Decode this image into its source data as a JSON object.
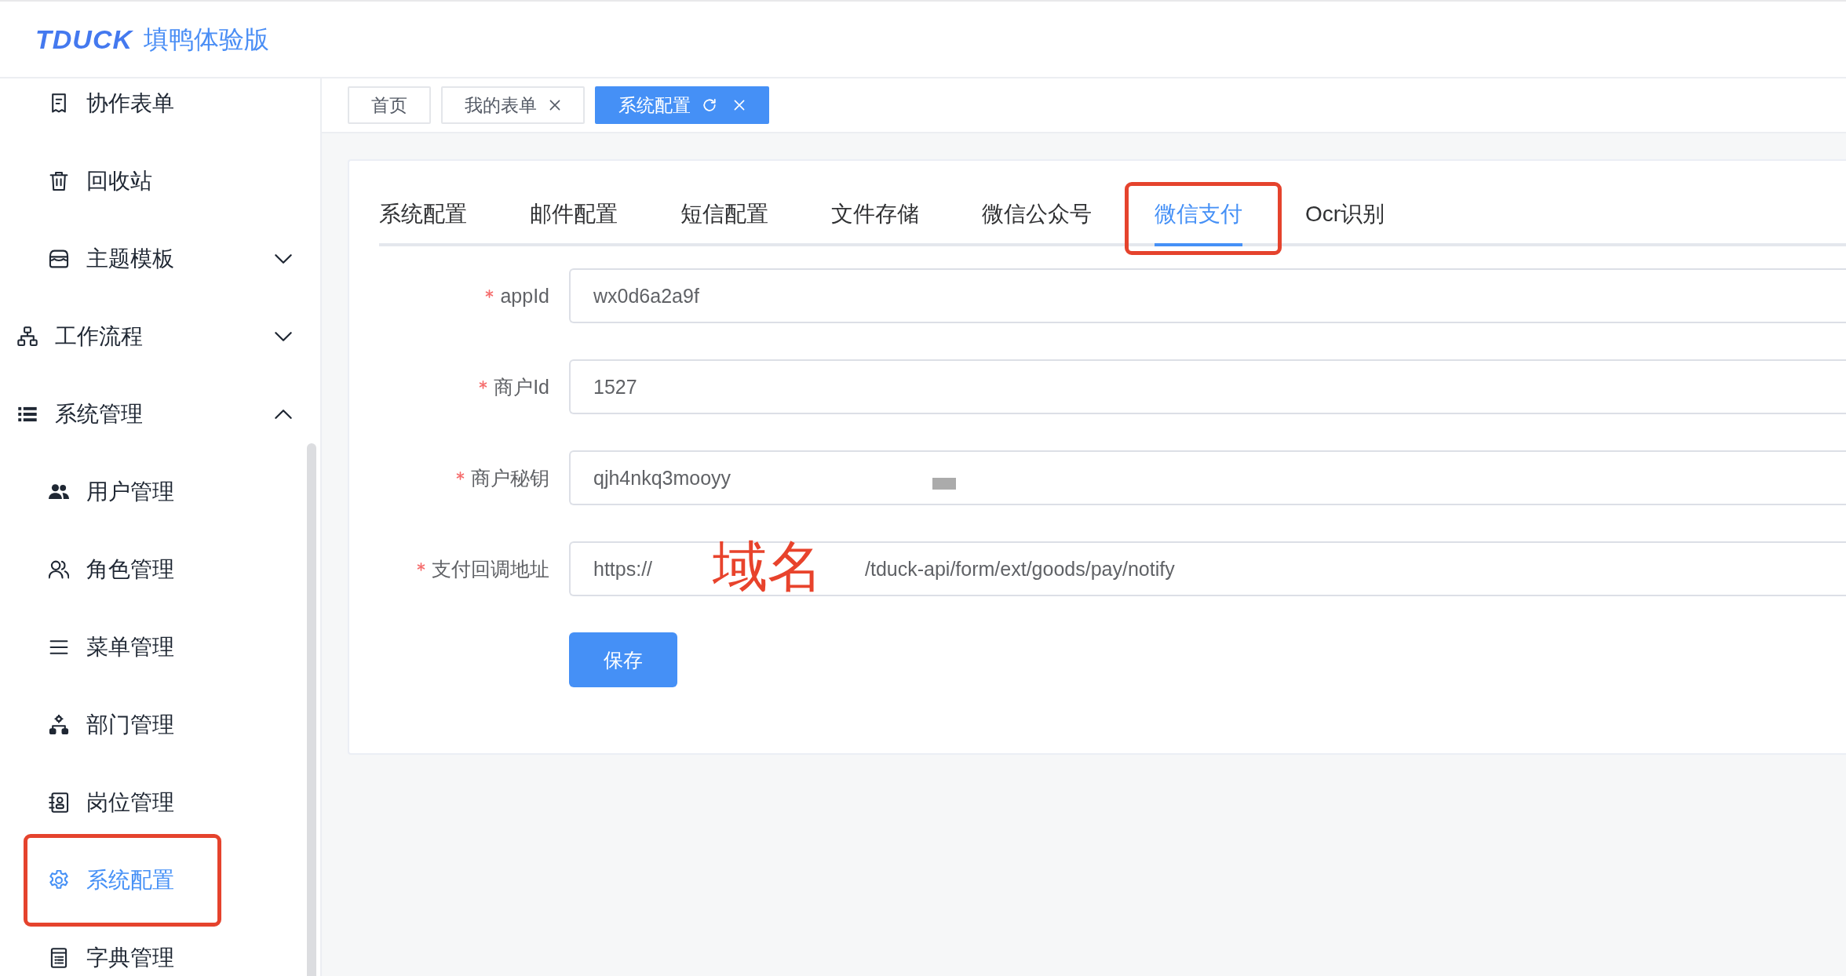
{
  "logo": {
    "brand": "TDUCK",
    "subtitle": "填鸭体验版"
  },
  "sidebar": {
    "items": [
      {
        "children": [
          {
            "label": "协作表单",
            "selected": false,
            "highlighted": false
          },
          {
            "label": "回收站",
            "selected": false,
            "highlighted": false
          },
          {
            "label": "主题模板",
            "selected": false,
            "highlighted": false,
            "expanded": false
          }
        ]
      },
      {
        "label": "工作流程",
        "selected": false,
        "highlighted": false,
        "expanded": false
      },
      {
        "label": "系统管理",
        "selected": false,
        "highlighted": false,
        "expanded": true,
        "children": [
          {
            "label": "用户管理",
            "selected": false,
            "highlighted": false
          },
          {
            "label": "角色管理",
            "selected": false,
            "highlighted": false
          },
          {
            "label": "菜单管理",
            "selected": false,
            "highlighted": false
          },
          {
            "label": "部门管理",
            "selected": false,
            "highlighted": false
          },
          {
            "label": "岗位管理",
            "selected": false,
            "highlighted": false
          },
          {
            "label": "系统配置",
            "selected": true,
            "highlighted": true
          },
          {
            "label": "字典管理",
            "selected": false,
            "highlighted": false
          }
        ]
      }
    ]
  },
  "tags": [
    {
      "label": "首页",
      "selected": false,
      "closable": false
    },
    {
      "label": "我的表单",
      "selected": false,
      "closable": true
    },
    {
      "label": "系统配置",
      "selected": true,
      "closable": true
    }
  ],
  "settings": {
    "tabs": [
      {
        "label": "系统配置",
        "selected": false,
        "highlighted": false
      },
      {
        "label": "邮件配置",
        "selected": false,
        "highlighted": false
      },
      {
        "label": "短信配置",
        "selected": false,
        "highlighted": false
      },
      {
        "label": "文件存储",
        "selected": false,
        "highlighted": false
      },
      {
        "label": "微信公众号",
        "selected": false,
        "highlighted": false
      },
      {
        "label": "微信支付",
        "selected": true,
        "highlighted": true
      },
      {
        "label": "Ocr识别",
        "selected": false,
        "highlighted": false
      }
    ],
    "fields": [
      {
        "label": "appId",
        "required": true,
        "value": "wx0d6a2a9f",
        "redaction_block": false
      },
      {
        "label": "商户Id",
        "required": true,
        "value": "1527",
        "redaction_block": false
      },
      {
        "label": "商户秘钥",
        "required": true,
        "value": "qjh4nkq3mooyy",
        "redaction_block": true
      },
      {
        "label": "支付回调地址",
        "required": true,
        "value": "https://",
        "value_tail": "/tduck-api/form/ext/goods/pay/notify",
        "annotation": "域名",
        "redaction_block": false
      }
    ],
    "save_button": "保存"
  }
}
